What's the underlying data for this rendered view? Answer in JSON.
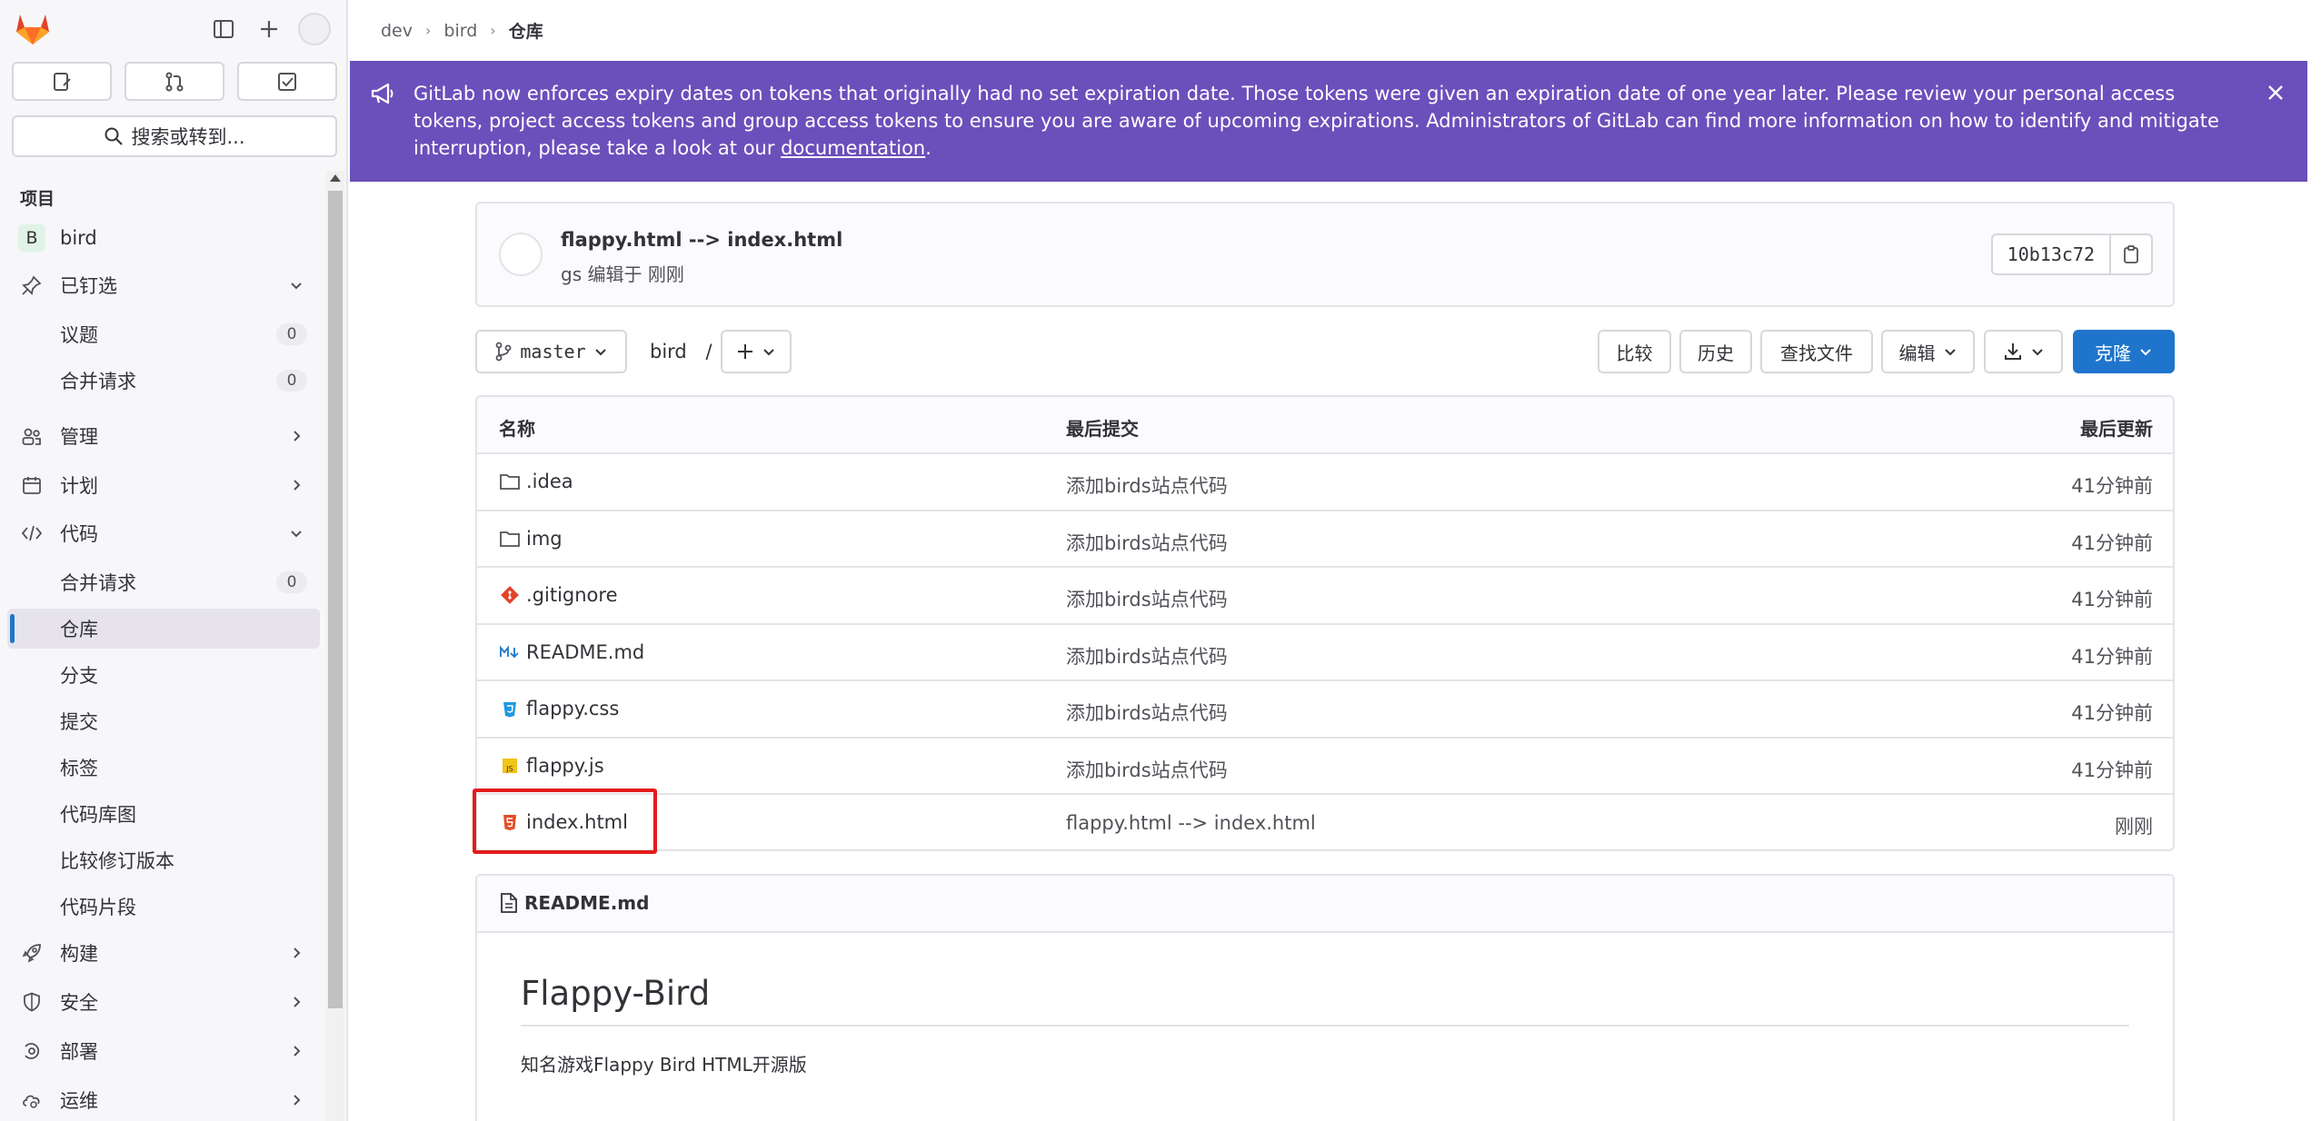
{
  "sidebar": {
    "search_label": "搜索或转到...",
    "section_title": "项目",
    "project": {
      "badge": "B",
      "name": "bird"
    },
    "items": [
      {
        "label": "已钉选",
        "chevron": "down"
      },
      {
        "label": "议题",
        "count": "0"
      },
      {
        "label": "合并请求",
        "count": "0"
      },
      {
        "label": "管理",
        "chevron": "right"
      },
      {
        "label": "计划",
        "chevron": "right"
      },
      {
        "label": "代码",
        "chevron": "down"
      },
      {
        "label": "合并请求",
        "count": "0"
      },
      {
        "label": "仓库"
      },
      {
        "label": "分支"
      },
      {
        "label": "提交"
      },
      {
        "label": "标签"
      },
      {
        "label": "代码库图"
      },
      {
        "label": "比较修订版本"
      },
      {
        "label": "代码片段"
      },
      {
        "label": "构建",
        "chevron": "right"
      },
      {
        "label": "安全",
        "chevron": "right"
      },
      {
        "label": "部署",
        "chevron": "right"
      },
      {
        "label": "运维",
        "chevron": "right"
      }
    ]
  },
  "breadcrumb": [
    "dev",
    "bird",
    "仓库"
  ],
  "banner": {
    "text": "GitLab now enforces expiry dates on tokens that originally had no set expiration date. Those tokens were given an expiration date of one year later. Please review your personal access tokens, project access tokens and group access tokens to ensure you are aware of upcoming expirations. Administrators of GitLab can find more information on how to identify and mitigate interruption, please take a look at our ",
    "link": "documentation",
    "suffix": ".",
    "color": "#6b4fbb"
  },
  "commit": {
    "title": "flappy.html --> index.html",
    "meta": "gs 编辑于 刚刚",
    "sha": "10b13c72"
  },
  "toolbar": {
    "branch": "master",
    "path": "bird",
    "path_sep": "/",
    "compare": "比较",
    "history": "历史",
    "find_file": "查找文件",
    "edit": "编辑",
    "clone": "克隆"
  },
  "table": {
    "headers": {
      "name": "名称",
      "last_commit": "最后提交",
      "last_update": "最后更新"
    },
    "rows": [
      {
        "name": ".idea",
        "icon": "folder-icon",
        "commit": "添加birds站点代码",
        "date": "41分钟前"
      },
      {
        "name": "img",
        "icon": "folder-icon",
        "commit": "添加birds站点代码",
        "date": "41分钟前"
      },
      {
        "name": ".gitignore",
        "icon": "git-icon",
        "commit": "添加birds站点代码",
        "date": "41分钟前"
      },
      {
        "name": "README.md",
        "icon": "markdown-icon",
        "commit": "添加birds站点代码",
        "date": "41分钟前"
      },
      {
        "name": "flappy.css",
        "icon": "css-icon",
        "commit": "添加birds站点代码",
        "date": "41分钟前"
      },
      {
        "name": "flappy.js",
        "icon": "js-icon",
        "commit": "添加birds站点代码",
        "date": "41分钟前"
      },
      {
        "name": "index.html",
        "icon": "html-icon",
        "commit": "flappy.html --> index.html",
        "date": "刚刚"
      }
    ]
  },
  "readme": {
    "file": "README.md",
    "heading": "Flappy-Bird",
    "paragraph": "知名游戏Flappy Bird HTML开源版"
  },
  "colors": {
    "accent": "#1f75cb",
    "highlight": "#e31c1c"
  }
}
